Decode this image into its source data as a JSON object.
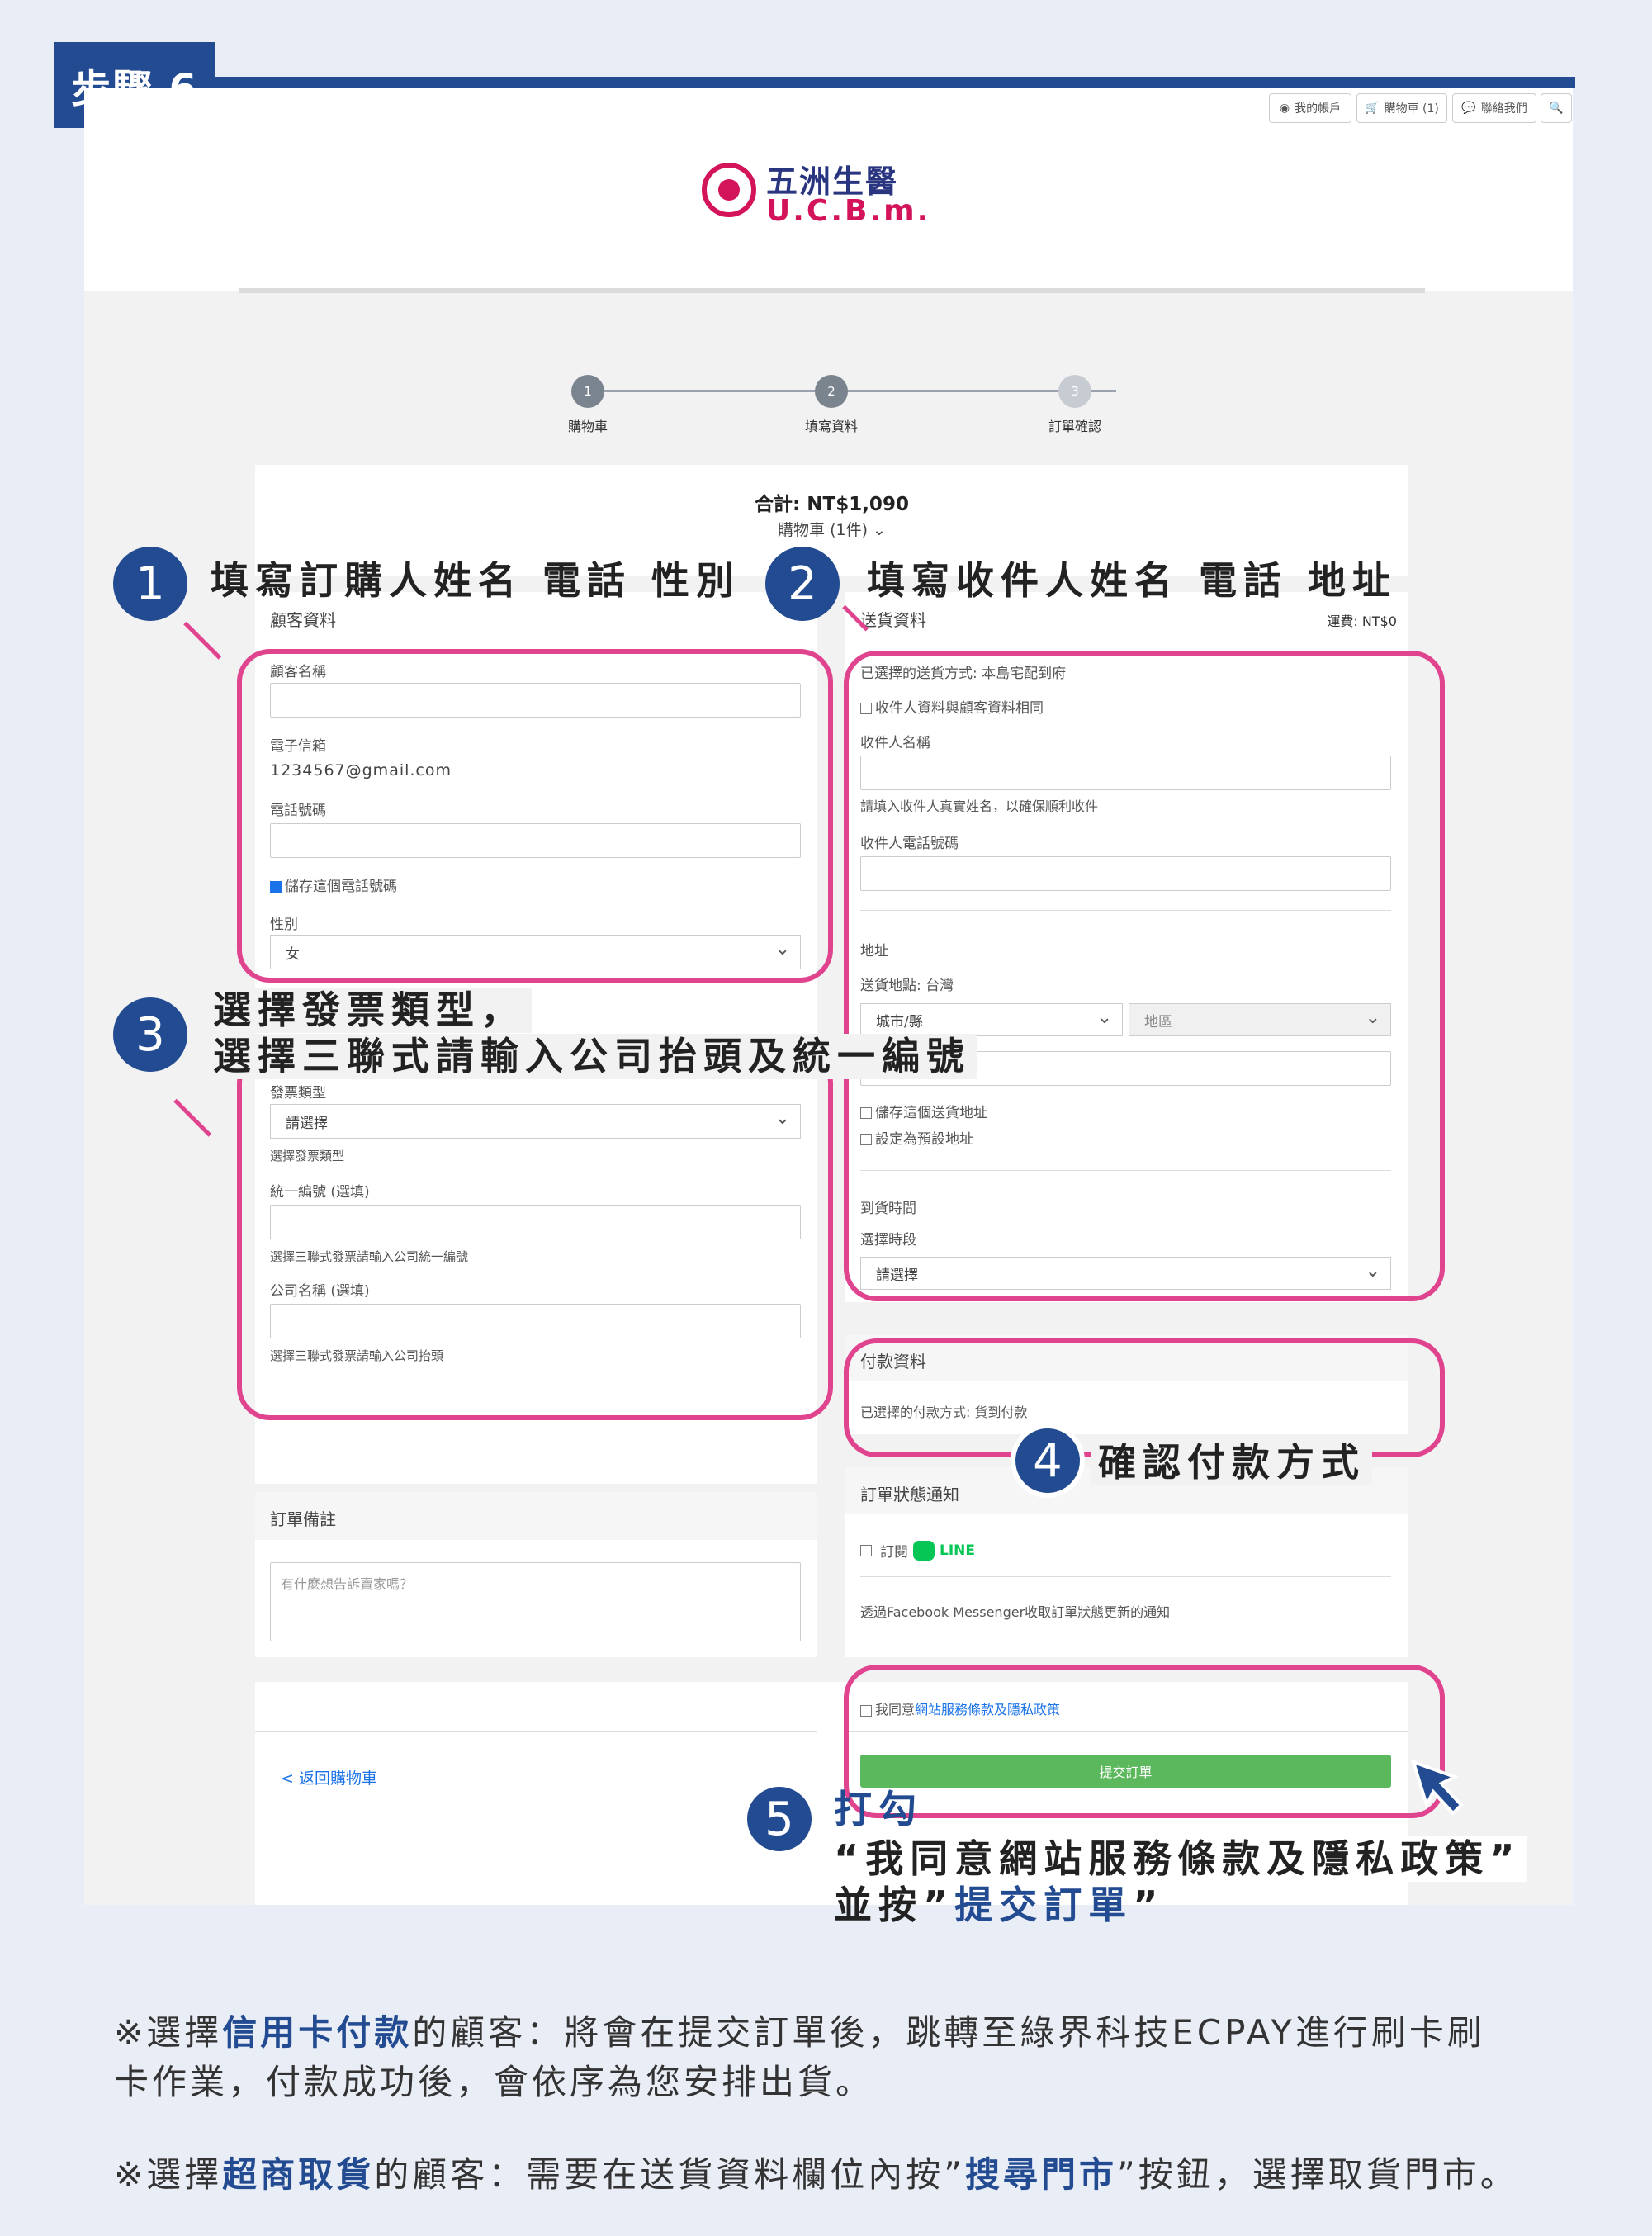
{
  "step_tag": "步驟 6",
  "header": {
    "links": [
      "我的帳戶",
      "購物車 (1)",
      "聯絡我們"
    ],
    "logo_cn": "五洲生醫",
    "logo_en": "U.C.B.m."
  },
  "progress": {
    "steps": [
      {
        "num": "1",
        "label": "購物車"
      },
      {
        "num": "2",
        "label": "填寫資料"
      },
      {
        "num": "3",
        "label": "訂單確認"
      }
    ]
  },
  "summary": {
    "total": "合計: NT$1,090",
    "cart": "購物車 (1件)"
  },
  "customer": {
    "title": "顧客資料",
    "name_label": "顧客名稱",
    "email_label": "電子信箱",
    "email_value": "1234567@gmail.com",
    "phone_label": "電話號碼",
    "save_phone": "儲存這個電話號碼",
    "gender_label": "性別",
    "gender_value": "女"
  },
  "invoice": {
    "type_label": "發票類型",
    "type_value": "請選擇",
    "type_hint": "選擇發票類型",
    "tax_label": "統一編號 (選填)",
    "tax_hint": "選擇三聯式發票請輸入公司統一編號",
    "company_label": "公司名稱 (選填)",
    "company_hint": "選擇三聯式發票請輸入公司抬頭"
  },
  "remarks": {
    "title": "訂單備註",
    "placeholder": "有什麼想告訴賣家嗎？"
  },
  "back_link": "< 返回購物車",
  "shipping": {
    "title": "送貨資料",
    "fee": "運費: NT$0",
    "method": "已選擇的送貨方式: 本島宅配到府",
    "same_as_customer": "收件人資料與顧客資料相同",
    "recipient_label": "收件人名稱",
    "recipient_hint": "請填入收件人真實姓名，以確保順利收件",
    "recipient_phone_label": "收件人電話號碼",
    "address_label": "地址",
    "location": "送貨地點: 台灣",
    "city_placeholder": "城市/縣",
    "district_placeholder": "地區",
    "save_address": "儲存這個送貨地址",
    "default_address": "設定為預設地址",
    "arrival_label": "到貨時間",
    "slot_label": "選擇時段",
    "slot_value": "請選擇"
  },
  "payment": {
    "title": "付款資料",
    "method": "已選擇的付款方式: 貨到付款"
  },
  "notify": {
    "title": "訂單狀態通知",
    "subscribe": "訂閱",
    "line_label": "LINE",
    "messenger": "透過Facebook Messenger收取訂單狀態更新的通知"
  },
  "agree": {
    "prefix": "我同意",
    "link": "網站服務條款及隱私政策",
    "submit": "提交訂單"
  },
  "annotations": {
    "a1": {
      "num": "1",
      "text": "填寫訂購人姓名 電話 性別"
    },
    "a2": {
      "num": "2",
      "text": "填寫收件人姓名 電話 地址"
    },
    "a3": {
      "num": "3",
      "line1": "選擇發票類型，",
      "line2": "選擇三聯式請輸入公司抬頭及統一編號"
    },
    "a4": {
      "num": "4",
      "text": "確認付款方式"
    },
    "a5": {
      "num": "5",
      "line1": "打勾",
      "line2": "“我同意網站服務條款及隱私政策”",
      "line3_prefix": "並按”",
      "line3_bold": "提交訂單",
      "line3_suffix": "”"
    }
  },
  "notes": {
    "n1_prefix": "※選擇",
    "n1_hl": "信用卡付款",
    "n1_rest": "的顧客：將會在提交訂單後，跳轉至綠界科技ECPAY進行刷卡刷",
    "n1_line2": "卡作業，付款成功後，會依序為您安排出貨。",
    "n2_prefix": "※選擇",
    "n2_hl": "超商取貨",
    "n2_mid": "的顧客：需要在送貨資料欄位內按”",
    "n2_hl2": "搜尋門市",
    "n2_suffix": "”按鈕，選擇取貨門市。"
  },
  "colors": {
    "brand_blue": "#224b92",
    "highlight_pink": "#e0448e",
    "submit_green": "#5cb85c",
    "logo_red": "#d4145a"
  }
}
